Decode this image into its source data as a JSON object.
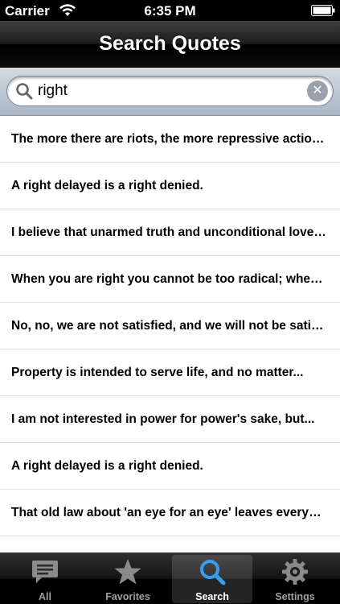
{
  "status_bar": {
    "carrier": "Carrier",
    "time": "6:35 PM"
  },
  "nav": {
    "title": "Search Quotes"
  },
  "search": {
    "query": "right",
    "clear_icon": "clear-icon"
  },
  "results": [
    "The more there are riots, the more repressive action will take place...",
    "A right delayed is a right denied.",
    "I believe that unarmed truth and unconditional love will have the final word...",
    "When you are right you cannot be too radical; when you are wrong...",
    "No, no, we are not satisfied, and we will not be satisfied...",
    "Property is intended to serve life, and no matter...",
    "I am not interested in power for power's sake, but...",
    "A right delayed is a right denied.",
    "That old law about 'an eye for an eye' leaves everybody blind..."
  ],
  "tabs": [
    {
      "label": "All",
      "icon": "speech-bubble-icon",
      "active": false
    },
    {
      "label": "Favorites",
      "icon": "star-icon",
      "active": false
    },
    {
      "label": "Search",
      "icon": "magnifier-icon",
      "active": true
    },
    {
      "label": "Settings",
      "icon": "gear-icon",
      "active": false
    }
  ],
  "colors": {
    "active_tab_icon": "#3b9ded",
    "inactive_tab_icon": "#8a8a8a"
  }
}
